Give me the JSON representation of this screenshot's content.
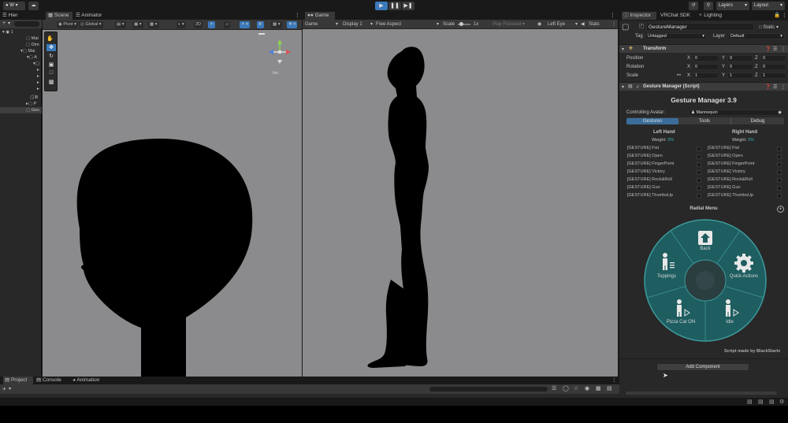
{
  "topbar": {
    "account_label": "W",
    "cloud_icon": "cloud-icon",
    "layers_label": "Layers",
    "layout_label": "Layout",
    "play_icon": "play-icon",
    "pause_icon": "pause-icon",
    "step_icon": "step-icon"
  },
  "hierarchy": {
    "tab_label": "Hier",
    "rows": [
      "Mai",
      "Dire",
      "Mai",
      "A",
      "",
      "",
      "",
      "",
      "",
      "B",
      "P",
      "Ges"
    ]
  },
  "scene": {
    "tab_scene": "Scene",
    "tab_animator": "Animator",
    "pivot_label": "Pivot",
    "global_label": "Global",
    "mode_2d": "2D",
    "persp_label": "Iso"
  },
  "game": {
    "tab_label": "Game",
    "mode_label": "Game",
    "display_label": "Display 1",
    "aspect_label": "Free Aspect",
    "scale_label": "Scale",
    "scale_value": "1x",
    "play_focused_label": "Play Focused",
    "eye_label": "Left Eye",
    "stats_label": "Stats"
  },
  "inspector": {
    "tabs": [
      "Inspector",
      "VRChat SDK",
      "Lighting"
    ],
    "object_name": "GestureManager",
    "static_label": "Static",
    "tag_label": "Tag",
    "tag_value": "Untagged",
    "layer_label": "Layer",
    "layer_value": "Default",
    "transform": {
      "title": "Transform",
      "position_label": "Position",
      "rotation_label": "Rotation",
      "scale_label": "Scale",
      "position": [
        "0",
        "0",
        "0"
      ],
      "rotation": [
        "0",
        "0",
        "0"
      ],
      "scale": [
        "1",
        "1",
        "1"
      ],
      "axis_x": "X",
      "axis_y": "Y",
      "axis_z": "Z"
    },
    "gesture_manager": {
      "component_title": "Gesture Manager (Script)",
      "heading": "Gesture Manager 3.9",
      "controlling_avatar_label": "Controlling Avatar:",
      "controlling_avatar_value": "Mannequin",
      "tabs": [
        "Gestures",
        "Tools",
        "Debug"
      ],
      "left_hand": {
        "title": "Left Hand",
        "weight_label": "Weight:",
        "weight_value": "0%",
        "items": [
          "[GESTURE] Fist",
          "[GESTURE] Open",
          "[GESTURE] FingerPoint",
          "[GESTURE] Victory",
          "[GESTURE] Rock&Roll",
          "[GESTURE] Gun",
          "[GESTURE] ThumbsUp"
        ]
      },
      "right_hand": {
        "title": "Right Hand",
        "weight_label": "Weight:",
        "weight_value": "0%",
        "items": [
          "[GESTURE] Fist",
          "[GESTURE] Open",
          "[GESTURE] FingerPoint",
          "[GESTURE] Victory",
          "[GESTURE] Rock&Roll",
          "[GESTURE] Gun",
          "[GESTURE] ThumbsUp"
        ]
      },
      "radial_menu": {
        "title": "Radial Menu",
        "items": [
          "Back",
          "Quick Actions",
          "Idle",
          "Pizza Cat ON",
          "Toppings"
        ]
      },
      "credit": "Script made by BlackStartx"
    },
    "add_component_label": "Add Component"
  },
  "bottom": {
    "tabs": [
      "Project",
      "Console",
      "Animation"
    ]
  },
  "colors": {
    "accent": "#3a79bb",
    "radial_fill": "#1e5d60",
    "radial_stroke": "#3e9a9c",
    "viewport_bg": "#8b8b8d",
    "panel_bg": "#282828"
  }
}
